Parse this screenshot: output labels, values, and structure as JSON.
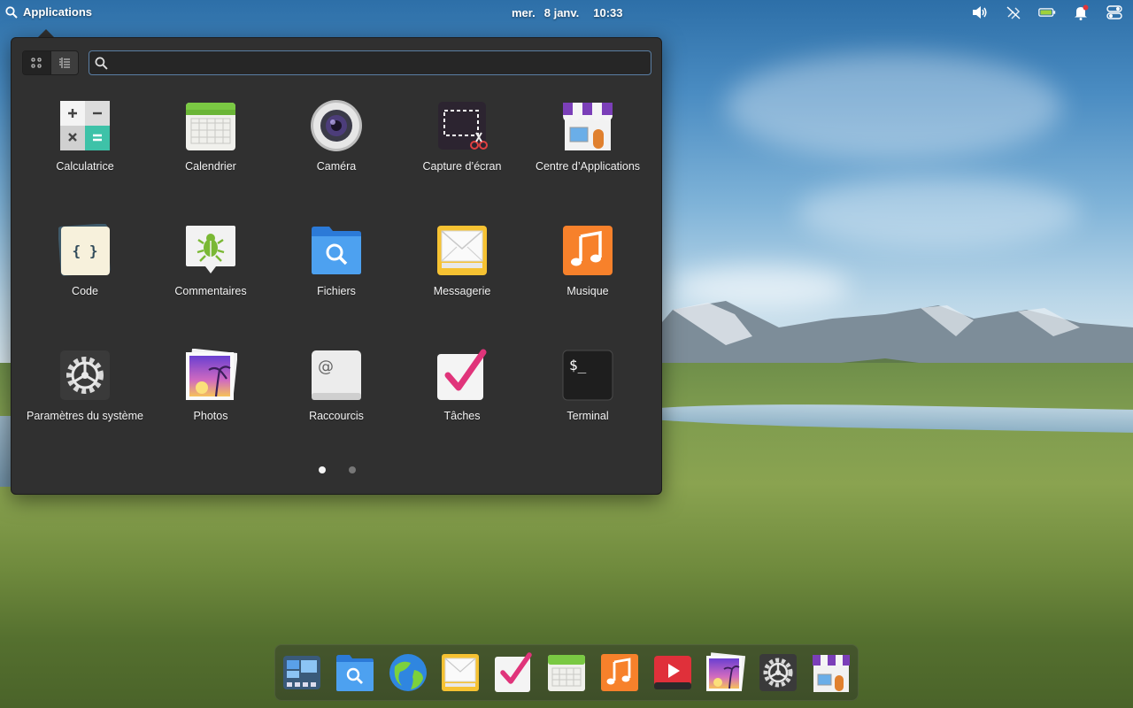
{
  "panel": {
    "applications_label": "Applications",
    "date_day": "mer.",
    "date": "8 janv.",
    "time": "10:33"
  },
  "tray": {
    "icons": [
      "volume-icon",
      "network-disconnected-icon",
      "battery-icon",
      "notification-bell-icon",
      "toggles-icon"
    ]
  },
  "launcher": {
    "search": {
      "placeholder": "",
      "value": ""
    },
    "view_modes": [
      "grid-view-icon",
      "category-view-icon"
    ],
    "apps": [
      {
        "label": "Calculatrice",
        "icon": "calculator-icon"
      },
      {
        "label": "Calendrier",
        "icon": "calendar-icon"
      },
      {
        "label": "Caméra",
        "icon": "camera-icon"
      },
      {
        "label": "Capture d’écran",
        "icon": "screenshot-icon"
      },
      {
        "label": "Centre d’Applications",
        "icon": "appcenter-icon"
      },
      {
        "label": "Code",
        "icon": "code-icon"
      },
      {
        "label": "Commentaires",
        "icon": "feedback-icon"
      },
      {
        "label": "Fichiers",
        "icon": "files-icon"
      },
      {
        "label": "Messagerie",
        "icon": "mail-icon"
      },
      {
        "label": "Musique",
        "icon": "music-icon"
      },
      {
        "label": "Paramètres du système",
        "icon": "settings-icon"
      },
      {
        "label": "Photos",
        "icon": "photos-icon"
      },
      {
        "label": "Raccourcis",
        "icon": "shortcuts-icon"
      },
      {
        "label": "Tâches",
        "icon": "tasks-icon"
      },
      {
        "label": "Terminal",
        "icon": "terminal-icon"
      }
    ],
    "pages": {
      "current": 1,
      "total": 2
    }
  },
  "dock": {
    "items": [
      "multitasking-view-icon",
      "files-icon",
      "web-browser-icon",
      "mail-icon",
      "tasks-icon",
      "calendar-icon",
      "music-icon",
      "videos-icon",
      "photos-icon",
      "settings-icon",
      "appcenter-icon"
    ]
  },
  "colors": {
    "accent": "#5a7ea3",
    "launcher_bg": "#303030"
  }
}
